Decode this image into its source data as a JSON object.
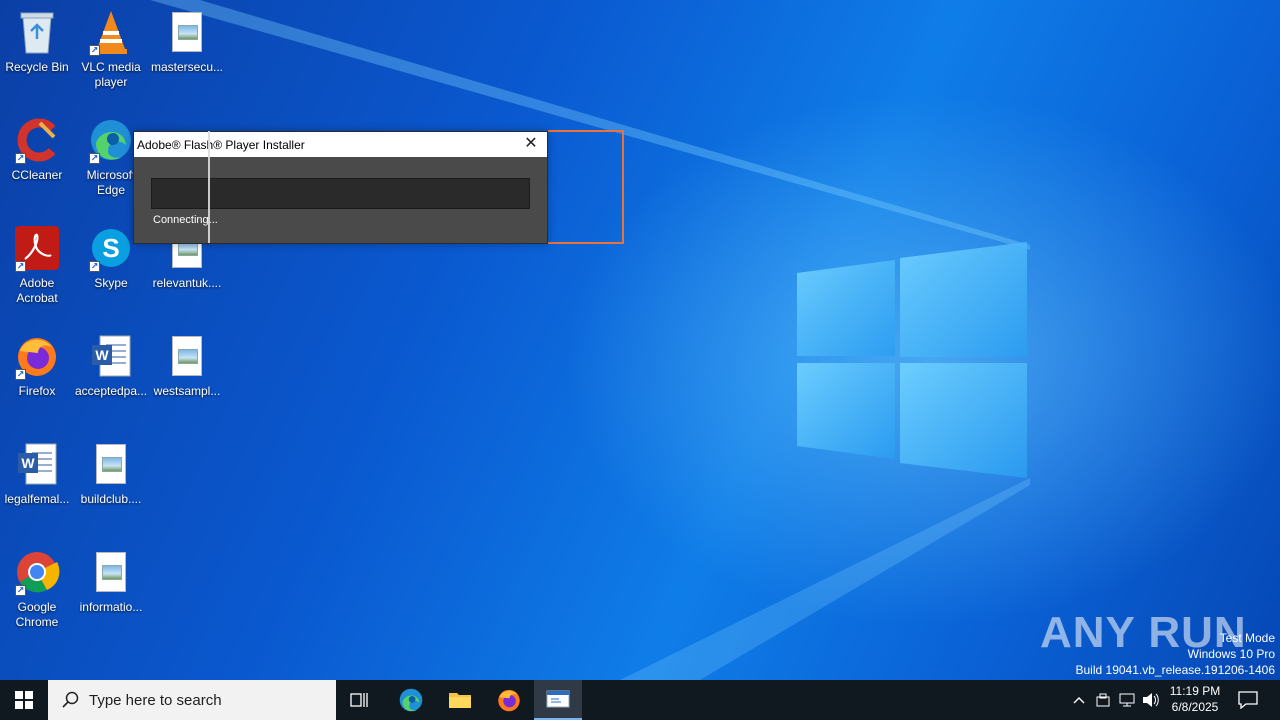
{
  "desktop": {
    "icons": [
      {
        "label": "Recycle Bin",
        "icon": "recycle-bin-icon"
      },
      {
        "label": "VLC media player",
        "icon": "vlc-icon"
      },
      {
        "label": "mastersecu...",
        "icon": "image-file-icon"
      },
      {
        "label": "CCleaner",
        "icon": "ccleaner-icon"
      },
      {
        "label": "Microsoft Edge",
        "icon": "edge-icon"
      },
      {
        "label": "Adobe Acrobat",
        "icon": "acrobat-icon"
      },
      {
        "label": "Skype",
        "icon": "skype-icon"
      },
      {
        "label": "relevantuk....",
        "icon": "image-file-icon"
      },
      {
        "label": "Firefox",
        "icon": "firefox-icon"
      },
      {
        "label": "acceptedpa...",
        "icon": "word-doc-icon"
      },
      {
        "label": "westsampl...",
        "icon": "image-file-icon"
      },
      {
        "label": "legalfemal...",
        "icon": "word-doc-icon"
      },
      {
        "label": "buildclub....",
        "icon": "image-file-icon"
      },
      {
        "label": "Google Chrome",
        "icon": "chrome-icon"
      },
      {
        "label": "informatio...",
        "icon": "image-file-icon"
      }
    ]
  },
  "dialog": {
    "title": "Adobe® Flash® Player Installer",
    "status": "Connecting...",
    "progress": 0,
    "close_glyph": "✕"
  },
  "watermark": {
    "brand": "ANY RUN",
    "line1": "Test Mode",
    "line2": "Windows 10 Pro",
    "line3": "Build 19041.vb_release.191206-1406"
  },
  "taskbar": {
    "search_placeholder": "Type here to search",
    "clock_time": "11:19 PM",
    "clock_date": "6/8/2025",
    "apps": [
      "task-view",
      "edge",
      "file-explorer",
      "firefox",
      "installer"
    ]
  },
  "colors": {
    "taskbar": "#101820",
    "dialog_bg": "#4a4a4a",
    "highlight_frame": "#e8743b"
  }
}
